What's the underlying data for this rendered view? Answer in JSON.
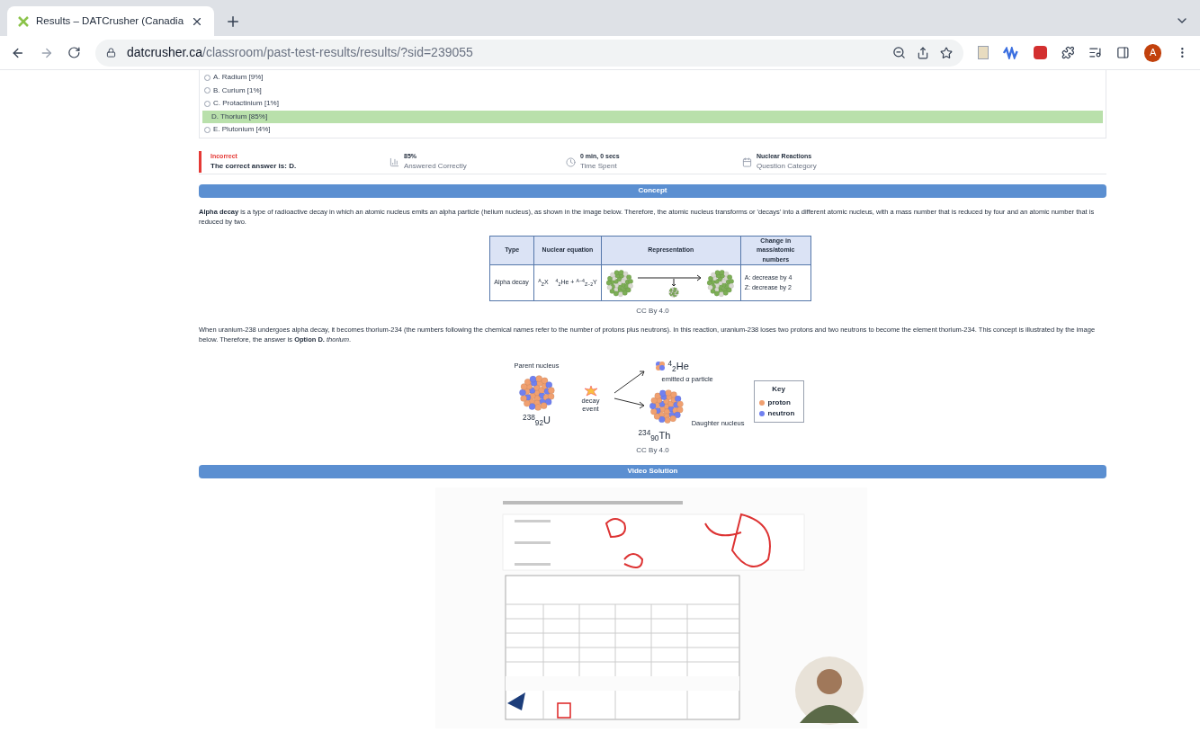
{
  "browser": {
    "tab_title": "Results – DATCrusher (Canadia",
    "url_domain": "datcrusher.ca",
    "url_path": "/classroom/past-test-results/results/?sid=239055",
    "profile_initial": "A"
  },
  "answers": [
    {
      "label": "A. Radium [9%]",
      "selected": false
    },
    {
      "label": "B. Curium [1%]",
      "selected": false
    },
    {
      "label": "C. Protactinium [1%]",
      "selected": false
    },
    {
      "label": "D. Thorium [85%]",
      "selected": true
    },
    {
      "label": "E. Plutonium [4%]",
      "selected": false
    }
  ],
  "result": {
    "status": "Incorrect",
    "detail": "The correct answer is: D."
  },
  "stats": [
    {
      "kind": "chart",
      "value": "85%",
      "caption": "Answered Correctly"
    },
    {
      "kind": "clock",
      "value": "0 min, 0 secs",
      "caption": "Time Spent"
    },
    {
      "kind": "calendar",
      "value": "Nuclear Reactions",
      "caption": "Question Category"
    }
  ],
  "concept": {
    "header": "Concept",
    "paragraph_1": "**Alpha decay** is a type of radioactive decay in which an atomic nucleus emits an alpha particle (helium nucleus), as shown in the image below. Therefore, the atomic nucleus transforms or 'decays' into a different atomic nucleus, with a mass number that is reduced by four and an atomic number that is reduced by two.",
    "table": {
      "columns": [
        "Type",
        "Nuclear equation",
        "Representation",
        "Change in mass/atomic numbers"
      ],
      "type": "Alpha decay",
      "equation_left": "$^{A}$$_{Z}$X",
      "equation_right": "$^{4}$$_{2}$He + $^{A−4}$$_{Z−2}$Y",
      "changes": [
        "A: decrease by 4",
        "Z: decrease by 2"
      ]
    },
    "credit_1": "CC By 4.0",
    "paragraph_2": "When uranium-238 undergoes alpha decay, it becomes thorium-234 (the numbers following the chemical names refer to the number of protons plus neutrons). In this reaction, uranium-238 loses two protons and two neutrons to become the element thorium-234. This concept is illustrated by the image below. Therefore, the answer is **Option D.** *thorium*.",
    "diagram": {
      "parent_label": "Parent nucleus",
      "parent_symbol": "$^{238}$$_{92}$U",
      "event_label": "decay event",
      "alpha_symbol": "$^{4}$$_{2}$He",
      "alpha_label": "emitted α particle",
      "daughter_label": "Daughter nucleus",
      "daughter_symbol": "$^{234}$$_{90}$Th",
      "key_title": "Key",
      "key_items": [
        {
          "label": "proton",
          "color": "#f0a070"
        },
        {
          "label": "neutron",
          "color": "#7080f0"
        }
      ]
    },
    "credit_2": "CC By 4.0"
  },
  "video": {
    "header": "Video Solution",
    "kind": "picture"
  }
}
